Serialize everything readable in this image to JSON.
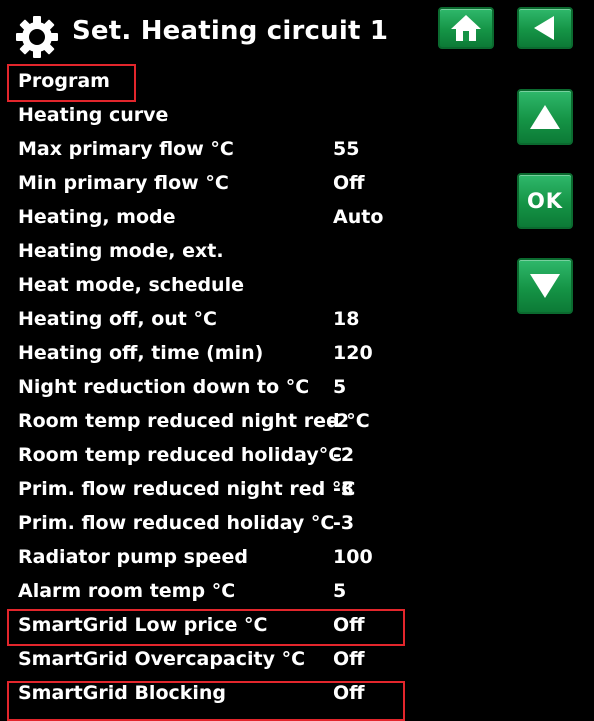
{
  "header": {
    "title": "Set. Heating circuit 1",
    "ok_label": "OK"
  },
  "icons": {
    "settings": "gear-icon",
    "home": "home-icon",
    "back": "back-arrow-icon",
    "up": "arrow-up-icon",
    "down": "arrow-down-icon"
  },
  "colors": {
    "button": "#159446",
    "highlight": "#e3262c",
    "background": "#000000",
    "text": "#ffffff"
  },
  "menu": {
    "items": [
      {
        "label": "Program",
        "value": ""
      },
      {
        "label": "Heating curve",
        "value": ""
      },
      {
        "label": "Max primary flow °C",
        "value": "55"
      },
      {
        "label": "Min primary flow °C",
        "value": "Off"
      },
      {
        "label": "Heating, mode",
        "value": "Auto"
      },
      {
        "label": "Heating mode, ext.",
        "value": ""
      },
      {
        "label": "Heat mode, schedule",
        "value": ""
      },
      {
        "label": "Heating off, out °C",
        "value": "18"
      },
      {
        "label": "Heating off, time (min)",
        "value": "120"
      },
      {
        "label": "Night reduction down to °C",
        "value": "5"
      },
      {
        "label": "Room temp reduced night red °C",
        "value": "-2"
      },
      {
        "label": "Room temp reduced holiday°C",
        "value": "-2"
      },
      {
        "label": "Prim. flow reduced night red °C",
        "value": "-3"
      },
      {
        "label": "Prim. flow reduced holiday °C",
        "value": "-3"
      },
      {
        "label": "Radiator pump speed",
        "value": "100"
      },
      {
        "label": "Alarm room temp °C",
        "value": "5"
      },
      {
        "label": "SmartGrid Low price °C",
        "value": "Off"
      },
      {
        "label": "SmartGrid Overcapacity °C",
        "value": "Off"
      },
      {
        "label": "SmartGrid Blocking",
        "value": "Off"
      }
    ]
  }
}
